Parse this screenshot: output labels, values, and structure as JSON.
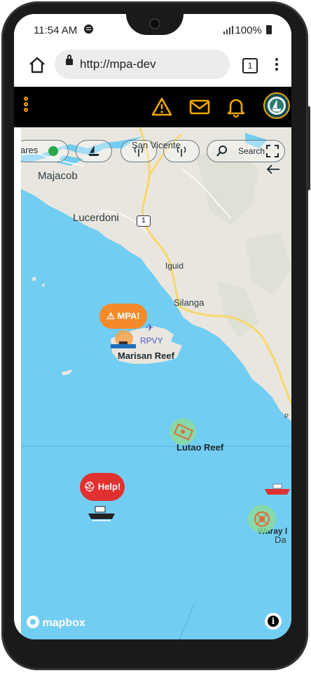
{
  "status_bar": {
    "time": "11:54 AM",
    "battery": "100%"
  },
  "browser": {
    "url": "http://mpa-dev",
    "tab_count": "1"
  },
  "app_header": {
    "icons": [
      "menu-dots-icon",
      "warning-icon",
      "mail-icon",
      "bell-icon",
      "avatar-logo"
    ],
    "accent_color": "#f0a800"
  },
  "map": {
    "filters": [
      {
        "label": "ares",
        "icon": "pin-icon"
      },
      {
        "label": "",
        "icon": "boat-icon"
      },
      {
        "label": "",
        "icon": "antenna-icon"
      },
      {
        "label": "",
        "icon": "antenna-icon"
      }
    ],
    "search_label": "Search",
    "places": {
      "san_vicente": "San Vicente",
      "majacob": "Majacob",
      "lucerdoni": "Lucerdoni",
      "iguid": "Iguid",
      "silanga": "Silanga",
      "rpvy": "RPVY",
      "marisan_reef": "Marisan Reef",
      "lutao_reef": "Lutao Reef",
      "waray": "Waray I",
      "da": "Da",
      "route": "1",
      "p": "P"
    },
    "alerts": {
      "mpa_label": "MPA!",
      "mpa_color": "#f58a2a",
      "help_label": "Help!",
      "help_color": "#e03030"
    },
    "attribution": "mapbox",
    "water_color": "#72cdf2",
    "land_color": "#e9e6df"
  }
}
